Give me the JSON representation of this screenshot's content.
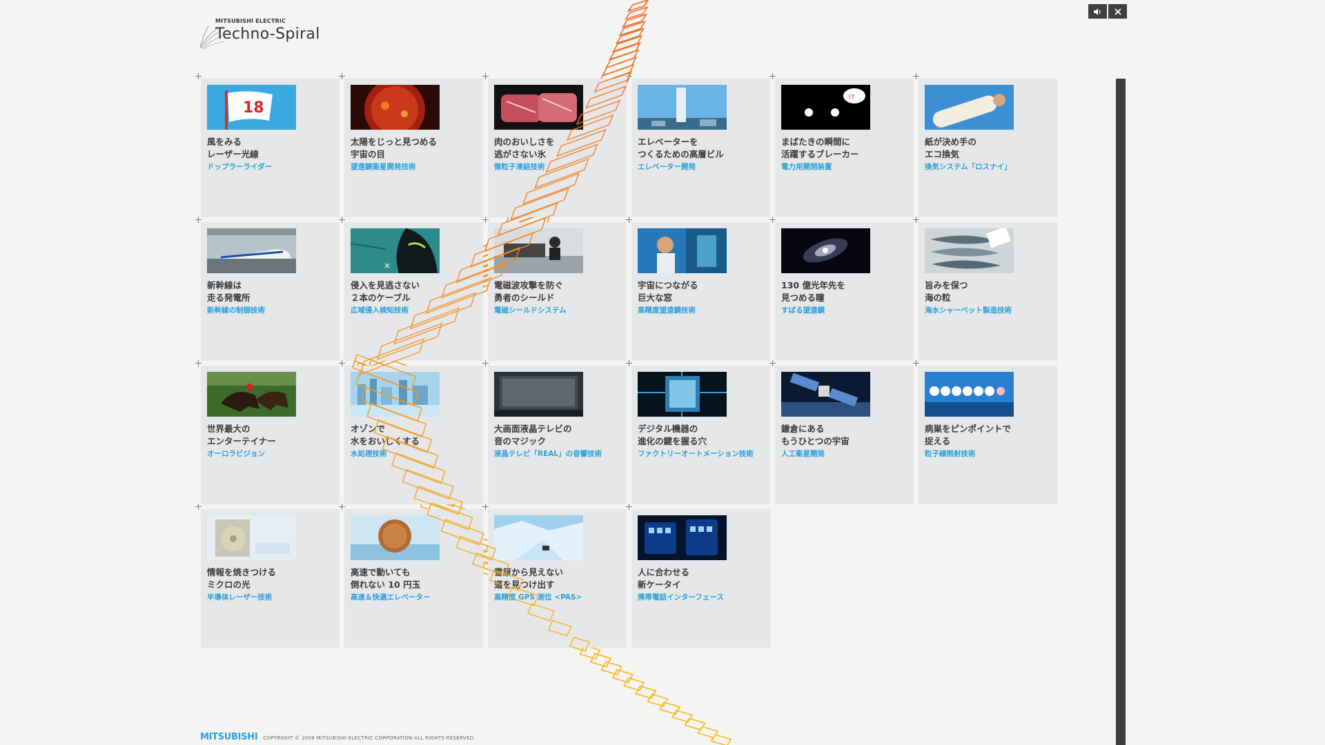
{
  "brand": {
    "company": "MITSUBISHI ELECTRIC",
    "name": "Techno-Spiral"
  },
  "controls": {
    "sound_icon": "speaker-icon",
    "close_icon": "close-icon"
  },
  "colors": {
    "tile_bg": "#e5e7e9",
    "subtitle": "#2aa0d8",
    "spiral_orange": "#f07b2a",
    "spiral_yellow": "#f5b61e"
  },
  "tiles": [
    {
      "line1": "風をみる",
      "line2": "レーザー光線",
      "sub": "ドップラーライダー",
      "icon": "flag-icon"
    },
    {
      "line1": "太陽をじっと見つめる",
      "line2": "宇宙の目",
      "sub": "望遠鏡衛星開発技術",
      "icon": "sun-icon"
    },
    {
      "line1": "肉のおいしさを",
      "line2": "逃がさない氷",
      "sub": "微粒子凍結技術",
      "icon": "meat-icon"
    },
    {
      "line1": "エレベーターを",
      "line2": "つくるための高層ビル",
      "sub": "エレベーター開発",
      "icon": "tower-icon"
    },
    {
      "line1": "まばたきの瞬間に",
      "line2": "活躍するブレーカー",
      "sub": "電力用開閉装置",
      "icon": "eyes-icon"
    },
    {
      "line1": "紙が決め手の",
      "line2": "エコ換気",
      "sub": "換気システム「ロスナイ」",
      "icon": "paper-roll-icon"
    },
    {
      "line1": "新幹線は",
      "line2": "走る発電所",
      "sub": "新幹線の制御技術",
      "icon": "train-icon"
    },
    {
      "line1": "侵入を見逃さない",
      "line2": "２本のケーブル",
      "sub": "広域侵入検知技術",
      "icon": "intruder-icon"
    },
    {
      "line1": "電磁波攻撃を防ぐ",
      "line2": "勇者のシールド",
      "sub": "電磁シールドシステム",
      "icon": "office-icon"
    },
    {
      "line1": "宇宙につながる",
      "line2": "巨大な窓",
      "sub": "高精度望遠鏡技術",
      "icon": "boy-icon"
    },
    {
      "line1": "130 億光年先を",
      "line2": "見つめる瞳",
      "sub": "すばる望遠鏡",
      "icon": "galaxy-icon"
    },
    {
      "line1": "旨みを保つ",
      "line2": "海の粒",
      "sub": "海水シャーベット製造技術",
      "icon": "fish-icon"
    },
    {
      "line1": "世界最大の",
      "line2": "エンターテイナー",
      "sub": "オーロラビジョン",
      "icon": "horse-race-icon"
    },
    {
      "line1": "オゾンで",
      "line2": "水をおいしくする",
      "sub": "水処理技術",
      "icon": "city-icon"
    },
    {
      "line1": "大画面液晶テレビの",
      "line2": "音のマジック",
      "sub": "液晶テレビ「REAL」の音響技術",
      "icon": "tv-icon"
    },
    {
      "line1": "デジタル機器の",
      "line2": "進化の鍵を握る穴",
      "sub": "ファクトリーオートメーション技術",
      "icon": "circuit-icon"
    },
    {
      "line1": "鎌倉にある",
      "line2": "もうひとつの宇宙",
      "sub": "人工衛星開発",
      "icon": "satellite-icon"
    },
    {
      "line1": "病巣をピンポイントで",
      "line2": "捉える",
      "sub": "粒子線照射技術",
      "icon": "balls-icon"
    },
    {
      "line1": "情報を焼きつける",
      "line2": "ミクロの光",
      "sub": "半導体レーザー技術",
      "icon": "disc-icon"
    },
    {
      "line1": "高速で動いても",
      "line2": "倒れない 10 円玉",
      "sub": "高速＆快適エレベーター",
      "icon": "coin-icon"
    },
    {
      "line1": "雪原から見えない",
      "line2": "道を見つけ出す",
      "sub": "高精度 GPS 測位 <PAS>",
      "icon": "snow-icon"
    },
    {
      "line1": "人に合わせる",
      "line2": "新ケータイ",
      "sub": "携帯電話インターフェース",
      "icon": "phone-icon"
    }
  ],
  "footer": {
    "logo": "MITSUBISHI",
    "copyright": "COPYRIGHT © 2008 MITSUBISHI ELECTRIC CORPORATION ALL RIGHTS RESERVED."
  }
}
